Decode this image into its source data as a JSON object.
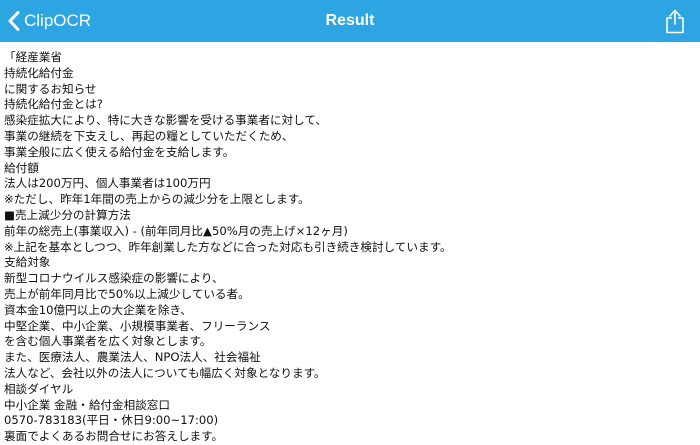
{
  "navbar": {
    "back_label": "ClipOCR",
    "title": "Result",
    "back_icon": "chevron-left-icon",
    "share_icon": "share-icon",
    "background_color": "#2ea5e3",
    "text_color": "#ffffff"
  },
  "result": {
    "lines": [
      "「経産業省",
      "持続化給付金",
      "に関するお知らせ",
      "持続化給付金とは?",
      "感染症拡大により、特に大きな影響を受ける事業者に対して、",
      "事業の継続を下支えし、再起の糧としていただくため、",
      "事業全般に広く使える給付金を支給します。",
      "給付額",
      "法人は200万円、個人事業者は100万円",
      "※ただし、昨年1年間の売上からの減少分を上限とします。",
      "■売上減少分の計算方法",
      "前年の総売上(事業収入) - (前年同月比▲50%月の売上げ×12ヶ月)",
      "※上記を基本としつつ、昨年創業した方などに合った対応も引き続き検討しています。",
      "支給対象",
      "新型コロナウイルス感染症の影響により、",
      "売上が前年同月比で50%以上減少している者。",
      "資本金10億円以上の大企業を除き、",
      "中堅企業、中小企業、小規模事業者、フリーランス",
      "を含む個人事業者を広く対象とします。",
      "また、医療法人、農業法人、NPO法人、社会福祉",
      "法人など、会社以外の法人についても幅広く対象となります。",
      "相談ダイヤル",
      "中小企業 金融・給付金相談窓口",
      "0570-783183(平日・休日9:00~17:00)",
      "裏面でよくあるお問合せにお答えします。"
    ]
  }
}
